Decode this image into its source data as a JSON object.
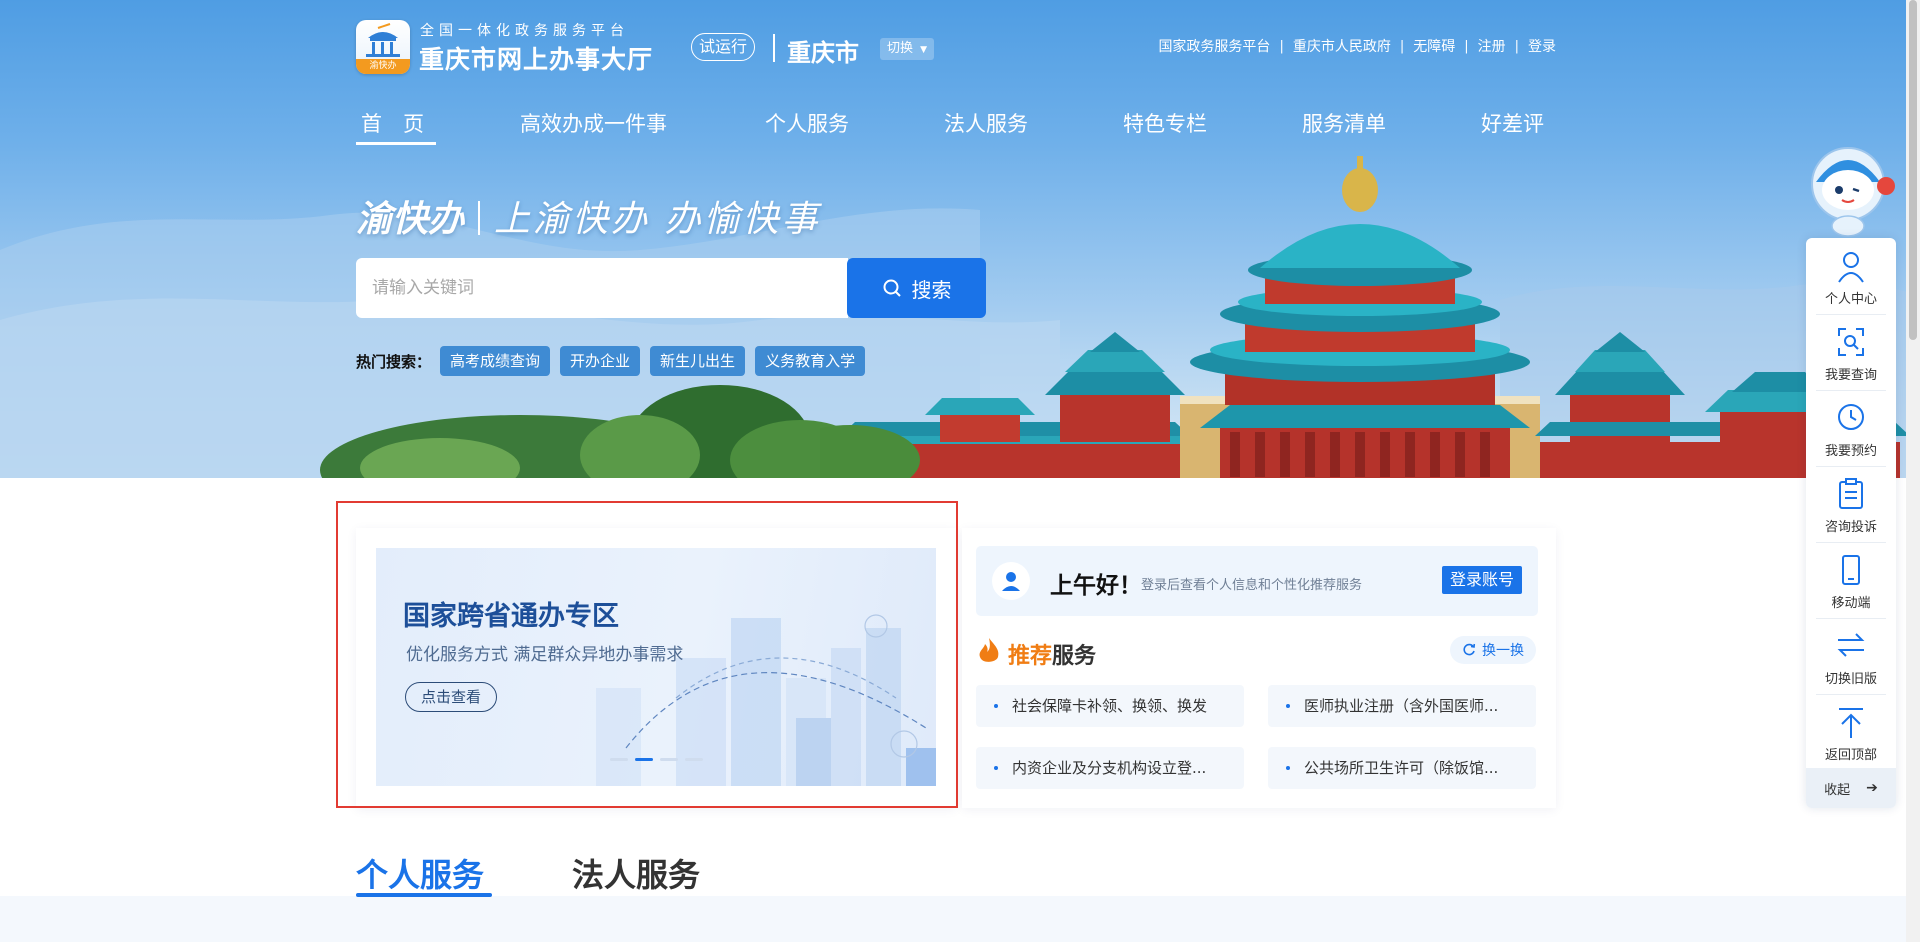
{
  "header": {
    "platform_subtitle": "全国一体化政务服务平台",
    "site_title": "重庆市网上办事大厅",
    "logo_tag": "渝快办",
    "trial_badge": "试运行",
    "city": "重庆市",
    "switch_label": "切换",
    "top_links": [
      "国家政务服务平台",
      "重庆市人民政府",
      "无障碍",
      "注册",
      "登录"
    ],
    "top_link_separator": "|"
  },
  "nav": {
    "items": [
      "首　页",
      "高效办成一件事",
      "个人服务",
      "法人服务",
      "特色专栏",
      "服务清单",
      "好差评"
    ],
    "active_index": 0
  },
  "hero": {
    "brand": "渝快办",
    "slogan": "上渝快办  办愉快事",
    "search_placeholder": "请输入关键词",
    "search_button": "搜索",
    "hot_label": "热门搜索：",
    "hot_tags": [
      "高考成绩查询",
      "开办企业",
      "新生儿出生",
      "义务教育入学"
    ]
  },
  "banner": {
    "title": "国家跨省通办专区",
    "subtitle": "优化服务方式  满足群众异地办事需求",
    "button": "点击查看",
    "slide_count": 4,
    "active_slide": 1
  },
  "user_panel": {
    "greeting": "上午好！",
    "hint": "登录后查看个人信息和个性化推荐服务",
    "login_button": "登录账号"
  },
  "recommend": {
    "title_highlight": "推荐",
    "title_rest": "服务",
    "refresh": "换一换",
    "items": [
      "社会保障卡补领、换领、换发",
      "医师执业注册（含外国医师...",
      "内资企业及分支机构设立登...",
      "公共场所卫生许可（除饭馆..."
    ]
  },
  "tabs": {
    "items": [
      "个人服务",
      "法人服务"
    ],
    "active_index": 0
  },
  "toolbar": {
    "items": [
      "个人中心",
      "我要查询",
      "我要预约",
      "咨询投诉",
      "移动端",
      "切换旧版",
      "返回顶部"
    ],
    "collapse": "收起"
  },
  "colors": {
    "primary": "#1a73e8",
    "accent_orange": "#f07d14",
    "highlight_frame": "#e23b32",
    "hot_tag_bg": "#3f8bd3"
  }
}
